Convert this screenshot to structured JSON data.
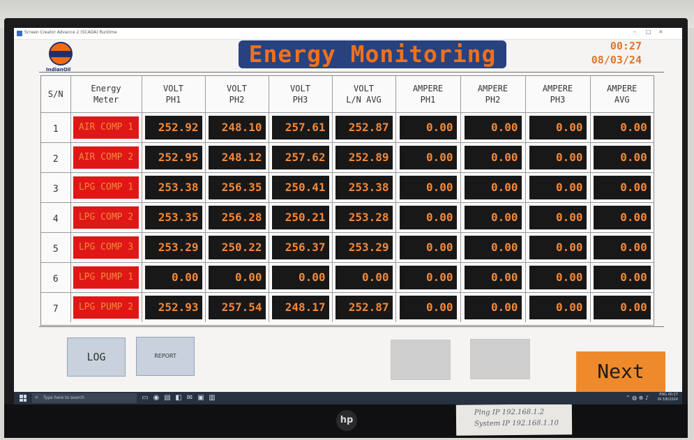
{
  "window": {
    "title": "Screen Creator Advance 2 (SCADA) Runtime"
  },
  "brand": {
    "name": "IndianOil"
  },
  "header": {
    "title": "Energy Monitoring",
    "time": "00:27",
    "date": "08/03/24"
  },
  "table": {
    "columns": [
      {
        "line1": "S/N",
        "line2": ""
      },
      {
        "line1": "Energy",
        "line2": "Meter"
      },
      {
        "line1": "VOLT",
        "line2": "PH1"
      },
      {
        "line1": "VOLT",
        "line2": "PH2"
      },
      {
        "line1": "VOLT",
        "line2": "PH3"
      },
      {
        "line1": "VOLT",
        "line2": "L/N AVG"
      },
      {
        "line1": "AMPERE",
        "line2": "PH1"
      },
      {
        "line1": "AMPERE",
        "line2": "PH2"
      },
      {
        "line1": "AMPERE",
        "line2": "PH3"
      },
      {
        "line1": "AMPERE",
        "line2": "AVG"
      }
    ],
    "rows": [
      {
        "sn": "1",
        "meter": "AIR COMP 1",
        "values": [
          "252.92",
          "248.10",
          "257.61",
          "252.87",
          "0.00",
          "0.00",
          "0.00",
          "0.00"
        ]
      },
      {
        "sn": "2",
        "meter": "AIR COMP 2",
        "values": [
          "252.95",
          "248.12",
          "257.62",
          "252.89",
          "0.00",
          "0.00",
          "0.00",
          "0.00"
        ]
      },
      {
        "sn": "3",
        "meter": "LPG COMP 1",
        "values": [
          "253.38",
          "256.35",
          "250.41",
          "253.38",
          "0.00",
          "0.00",
          "0.00",
          "0.00"
        ]
      },
      {
        "sn": "4",
        "meter": "LPG COMP 2",
        "values": [
          "253.35",
          "256.28",
          "250.21",
          "253.28",
          "0.00",
          "0.00",
          "0.00",
          "0.00"
        ]
      },
      {
        "sn": "5",
        "meter": "LPG COMP 3",
        "values": [
          "253.29",
          "250.22",
          "256.37",
          "253.29",
          "0.00",
          "0.00",
          "0.00",
          "0.00"
        ]
      },
      {
        "sn": "6",
        "meter": "LPG PUMP 1",
        "values": [
          "0.00",
          "0.00",
          "0.00",
          "0.00",
          "0.00",
          "0.00",
          "0.00",
          "0.00"
        ]
      },
      {
        "sn": "7",
        "meter": "LPG PUMP 2",
        "values": [
          "252.93",
          "257.54",
          "248.17",
          "252.87",
          "0.00",
          "0.00",
          "0.00",
          "0.00"
        ]
      }
    ]
  },
  "buttons": {
    "log": "LOG",
    "report": "REPORT",
    "next": "Next"
  },
  "taskbar": {
    "search_placeholder": "Type here to search",
    "lang": "ENG",
    "region": "IN",
    "time": "00:27",
    "date": "3/8/2024"
  },
  "sticker": {
    "line1": "Plng IP 192.168.1.2",
    "line2": "System IP 192.168.1.10"
  },
  "monitor": {
    "brand_logo": "hp"
  },
  "colors": {
    "title_bg": "#27427f",
    "title_text": "#f2701c",
    "meter_tag": "#e01717",
    "value_bg": "#181818",
    "value_text": "#f2883a",
    "next_button": "#ef8a2c"
  }
}
